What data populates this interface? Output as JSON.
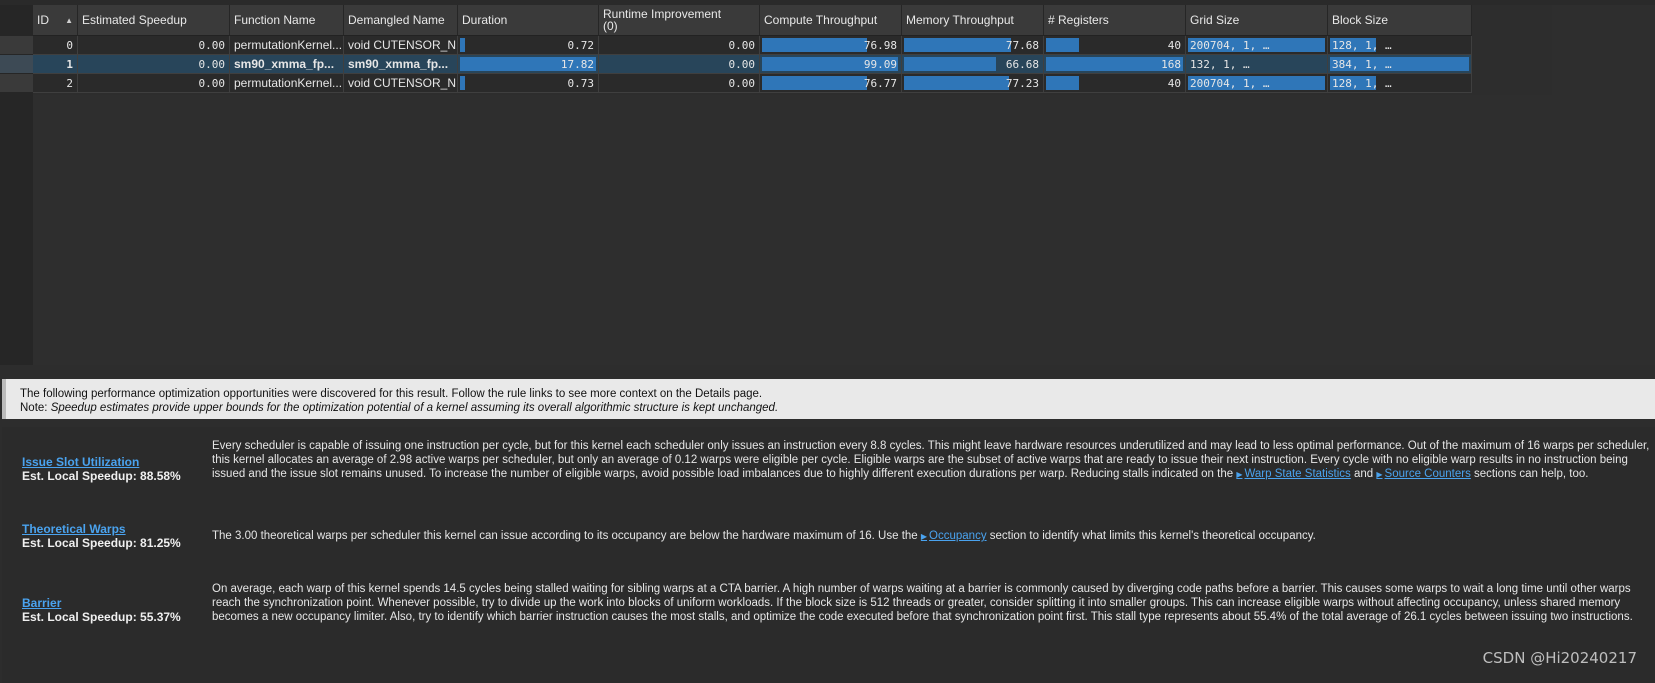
{
  "columns": {
    "id": "ID",
    "estimated_speedup": "Estimated Speedup",
    "function_name": "Function Name",
    "demangled_name": "Demangled Name",
    "duration": "Duration",
    "runtime_improvement": "Runtime Improvement",
    "runtime_improvement_sub": "(0)",
    "compute_throughput": "Compute Throughput",
    "memory_throughput": "Memory Throughput",
    "registers": "# Registers",
    "grid_size": "Grid Size",
    "block_size": "Block Size"
  },
  "rows": [
    {
      "id": "0",
      "speedup": "0.00",
      "function": "permutationKernel...",
      "demangled": "void CUTENSOR_N...",
      "duration": "0.72",
      "duration_fill": 0.04,
      "runtime": "0.00",
      "compute": "76.98",
      "compute_fill": 0.77,
      "memory": "77.68",
      "memory_fill": 0.78,
      "registers": "40",
      "registers_fill": 0.24,
      "grid": "200704,    1,  …",
      "grid_fill": 1.0,
      "block": "128,    1,    …",
      "block_fill": 0.33
    },
    {
      "id": "1",
      "speedup": "0.00",
      "function": "sm90_xmma_fp...",
      "demangled": "sm90_xmma_fp...",
      "duration": "17.82",
      "duration_fill": 1.0,
      "runtime": "0.00",
      "compute": "99.09",
      "compute_fill": 0.99,
      "memory": "66.68",
      "memory_fill": 0.67,
      "registers": "168",
      "registers_fill": 1.0,
      "grid": "132,    1,    …",
      "grid_fill": 0.0,
      "block": "384,    1,    …",
      "block_fill": 1.0
    },
    {
      "id": "2",
      "speedup": "0.00",
      "function": "permutationKernel...",
      "demangled": "void CUTENSOR_N...",
      "duration": "0.73",
      "duration_fill": 0.04,
      "runtime": "0.00",
      "compute": "76.77",
      "compute_fill": 0.77,
      "memory": "77.23",
      "memory_fill": 0.77,
      "registers": "40",
      "registers_fill": 0.24,
      "grid": "200704,    1,  …",
      "grid_fill": 1.0,
      "block": "128,    1,    …",
      "block_fill": 0.33
    }
  ],
  "notice": {
    "line1": "The following performance optimization opportunities were discovered for this result. Follow the rule links to see more context on the Details page.",
    "note_label": "Note: ",
    "note_text": "Speedup estimates provide upper bounds for the optimization potential of a kernel assuming its overall algorithmic structure is kept unchanged."
  },
  "rules": [
    {
      "title": "Issue Slot Utilization",
      "speedup": "Est. Local Speedup: 88.58%",
      "text_a": "Every scheduler is capable of issuing one instruction per cycle, but for this kernel each scheduler only issues an instruction every 8.8 cycles. This might leave hardware resources underutilized and may lead to less optimal performance. Out of the maximum of 16 warps per scheduler, this kernel allocates an average of 2.98 active warps per scheduler, but only an average of 0.12 warps were eligible per cycle. Eligible warps are the subset of active warps that are ready to issue their next instruction. Every cycle with no eligible warp results in no instruction being issued and the issue slot remains unused. To increase the number of eligible warps, avoid possible load imbalances due to highly different execution durations per warp. Reducing stalls indicated on the ",
      "link_1": "Warp State Statistics",
      "text_b": " and ",
      "link_2": "Source Counters",
      "text_c": " sections can help, too."
    },
    {
      "title": "Theoretical Warps",
      "speedup": "Est. Local Speedup: 81.25%",
      "text_a": "The 3.00 theoretical warps per scheduler this kernel can issue according to its occupancy are below the hardware maximum of 16. Use the ",
      "link_1": "Occupancy",
      "text_b": " section to identify what limits this kernel's theoretical occupancy."
    },
    {
      "title": "Barrier",
      "speedup": "Est. Local Speedup: 55.37%",
      "text_a": "On average, each warp of this kernel spends 14.5 cycles being stalled waiting for sibling warps at a CTA barrier. A high number of warps waiting at a barrier is commonly caused by diverging code paths before a barrier. This causes some warps to wait a long time until other warps reach the synchronization point. Whenever possible, try to divide up the work into blocks of uniform workloads. If the block size is 512 threads or greater, consider splitting it into smaller groups. This can increase eligible warps without affecting occupancy, unless shared memory becomes a new occupancy limiter. Also, try to identify which barrier instruction causes the most stalls, and optimize the code executed before that synchronization point first. This stall type represents about 55.4% of the total average of 26.1 cycles between issuing two instructions."
    }
  ],
  "watermark": "CSDN @Hi20240217",
  "colors": {
    "bar": "#2f76b8",
    "link": "#4aa3ef",
    "selected_row": "#28455a"
  }
}
